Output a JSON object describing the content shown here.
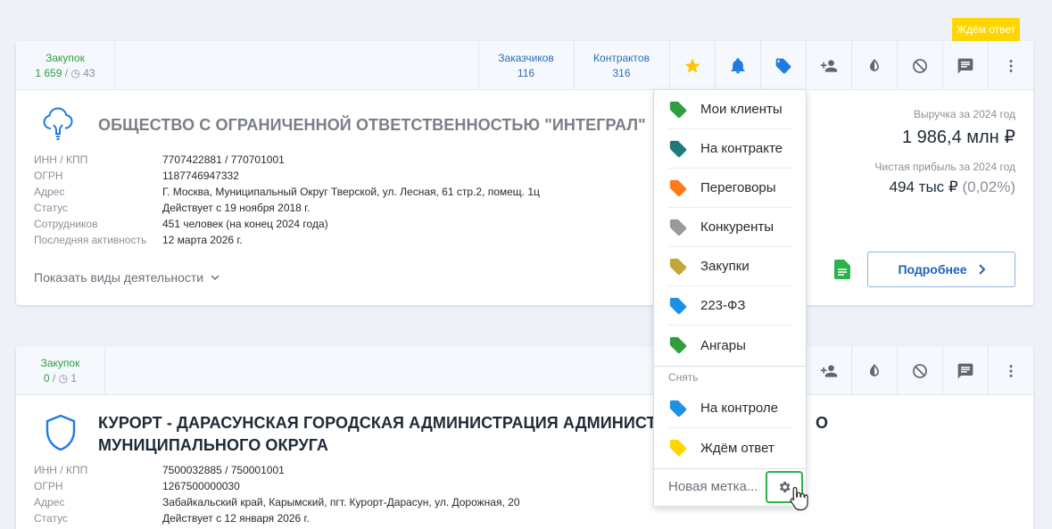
{
  "badge_wait": "Ждём ответ",
  "card1": {
    "purchases_label": "Закупок",
    "purchases_value": "1 659",
    "purchases_sep": " / ",
    "purchases_pending": "43",
    "customers_label": "Заказчиков",
    "customers_value": "116",
    "contracts_label": "Контрактов",
    "contracts_value": "316",
    "title": "ОБЩЕСТВО С ОГРАНИЧЕННОЙ ОТВЕТСТВЕННОСТЬЮ \"ИНТЕГРАЛ\"",
    "info": [
      {
        "k": "ИНН / КПП",
        "v": "7707422881 / 770701001"
      },
      {
        "k": "ОГРН",
        "v": "1187746947332"
      },
      {
        "k": "Адрес",
        "v": "Г. Москва, Муниципальный Округ Тверской, ул. Лесная, 61 стр.2, помещ. 1ц"
      },
      {
        "k": "Статус",
        "v": "Действует с 19 ноября 2018 г."
      },
      {
        "k": "Сотрудников",
        "v": "451 человек (на конец 2024 года)"
      },
      {
        "k": "Последняя активность",
        "v": "12 марта 2026 г."
      }
    ],
    "show_activities": "Показать виды деятельности",
    "revenue_label": "Выручка за 2024 год",
    "revenue_value": "1 986,4 млн ₽",
    "profit_label": "Чистая прибыль за 2024 год",
    "profit_value": "494 тыс ₽",
    "profit_pct": "(0,02%)",
    "more_button": "Подробнее"
  },
  "card2": {
    "purchases_label": "Закупок",
    "purchases_value": "0",
    "purchases_sep": " / ",
    "purchases_pending": "1",
    "title_line1": "КУРОРТ - ДАРАСУНСКАЯ ГОРОДСКАЯ АДМИНИСТРАЦИЯ АДМИНИСТР",
    "title_line1_tail": "О",
    "title_line2": "МУНИЦИПАЛЬНОГО ОКРУГА",
    "info": [
      {
        "k": "ИНН / КПП",
        "v": "7500032885 / 750001001"
      },
      {
        "k": "ОГРН",
        "v": "1267500000030"
      },
      {
        "k": "Адрес",
        "v": "Забайкальский край, Карымский, пгт. Курорт-Дарасун, ул. Дорожная, 20"
      },
      {
        "k": "Статус",
        "v": "Действует с 12 января 2026 г."
      }
    ]
  },
  "tag_menu": {
    "items": [
      {
        "label": "Мои клиенты",
        "color": "#2e9e3e"
      },
      {
        "label": "На контракте",
        "color": "#1f7a7a"
      },
      {
        "label": "Переговоры",
        "color": "#ff7a1a"
      },
      {
        "label": "Конкуренты",
        "color": "#9a9a9a"
      },
      {
        "label": "Закупки",
        "color": "#c2a83a"
      },
      {
        "label": "223-ФЗ",
        "color": "#1e90e8"
      },
      {
        "label": "Ангары",
        "color": "#2e9e3e"
      }
    ],
    "remove_header": "Снять",
    "remove_items": [
      {
        "label": "На контроле",
        "color": "#1e90e8"
      },
      {
        "label": "Ждём ответ",
        "color": "#ffd600"
      }
    ],
    "new_tag": "Новая метка..."
  },
  "colors": {
    "star": "#ffc400",
    "bell": "#1e7be0",
    "tag": "#1e7be0",
    "icon_grey": "#5f6670",
    "doc_green": "#2ab34a"
  }
}
